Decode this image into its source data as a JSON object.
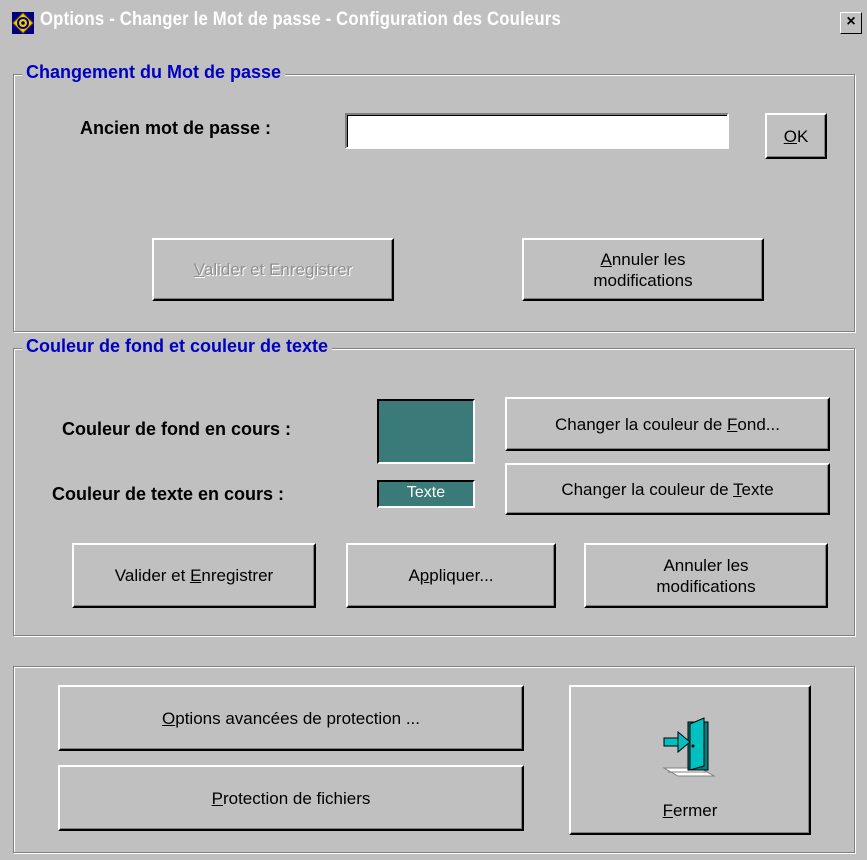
{
  "window": {
    "title": "Options - Changer le Mot de passe - Configuration des Couleurs",
    "close_label": "×"
  },
  "password_group": {
    "legend": "Changement du Mot de passe",
    "old_password_label": "Ancien mot de passe :",
    "old_password_value": "",
    "ok_button": {
      "accel": "O",
      "rest": "K"
    },
    "validate_button": {
      "accel": "V",
      "rest": "alider et Enregistrer",
      "enabled": false
    },
    "cancel_button": {
      "accel": "A",
      "rest": "nnuler les",
      "line2": "modifications"
    }
  },
  "color_group": {
    "legend": "Couleur de fond et couleur de texte",
    "bg_label": "Couleur de fond en cours :",
    "text_label": "Couleur de texte en cours :",
    "text_sample": "Texte",
    "current_color": "#3a7a78",
    "change_bg_button": {
      "pre": "Changer la couleur de ",
      "accel": "F",
      "post": "ond..."
    },
    "change_text_button": {
      "pre": "Changer la couleur de ",
      "accel": "T",
      "post": "exte"
    },
    "validate_button": {
      "pre": "Valider et ",
      "accel": "E",
      "post": "nregistrer"
    },
    "apply_button": {
      "pre": "A",
      "accel": "p",
      "post": "pliquer..."
    },
    "cancel_button": {
      "line1": "Annuler les",
      "line2": "modifications"
    }
  },
  "bottom": {
    "advanced_button": {
      "accel": "O",
      "rest": "ptions avancées de protection ..."
    },
    "files_button": {
      "accel": "P",
      "rest": "rotection de fichiers"
    },
    "close_button": {
      "accel": "F",
      "rest": "ermer"
    },
    "exit_icon": "exit-door-icon"
  }
}
